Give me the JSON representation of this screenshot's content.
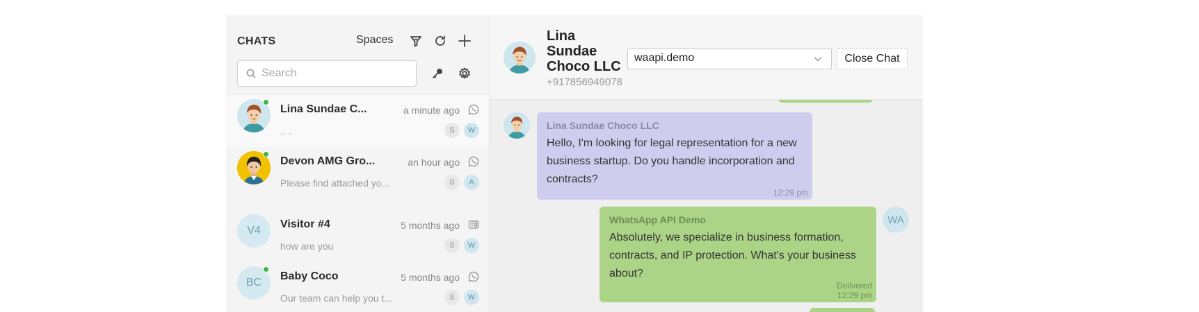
{
  "sidebar": {
    "title": "CHATS",
    "spaces_label": "Spaces",
    "search": {
      "placeholder": "Search",
      "value": ""
    },
    "chats": [
      {
        "name": "Lina Sundae C...",
        "time": "a minute ago",
        "preview": ".. .",
        "badge_s": "S",
        "badge_w": "W",
        "online": true,
        "channel": "whatsapp"
      },
      {
        "name": "Devon AMG Gro...",
        "time": "an hour ago",
        "preview": "Please find attached yo...",
        "badge_s": "S",
        "badge_w": "A",
        "online": true,
        "channel": "whatsapp"
      },
      {
        "name": "Visitor #4",
        "initials": "V4",
        "time": "5 months ago",
        "preview": "how are you",
        "badge_s": "S",
        "badge_w": "W",
        "online": false,
        "channel": "webchat"
      },
      {
        "name": "Baby Coco",
        "initials": "BC",
        "time": "5 months ago",
        "preview": "Our team can help you t...",
        "badge_s": "S",
        "badge_w": "W",
        "online": true,
        "channel": "whatsapp"
      }
    ]
  },
  "header": {
    "contact_name": "Lina Sundae Choco LLC",
    "phone": "+917856949078",
    "account_select": "waapi.demo",
    "close_label": "Close Chat"
  },
  "messages": [
    {
      "direction": "in",
      "sender": "Lina Sundae Choco LLC",
      "text": "Hello, I'm looking for legal representation for a new business startup. Do you handle incorporation and contracts?",
      "time": "12:29 pm"
    },
    {
      "direction": "out",
      "sender": "WhatsApp API Demo",
      "avatar_initials": "WA",
      "text": "Absolutely, we specialize in business formation, contracts, and IP protection. What's your business about?",
      "status": "Delivered",
      "time": "12:29 pm"
    }
  ],
  "colors": {
    "incoming_bubble": "#cfcdee",
    "outgoing_bubble": "#acd487",
    "online": "#3ab54a"
  }
}
